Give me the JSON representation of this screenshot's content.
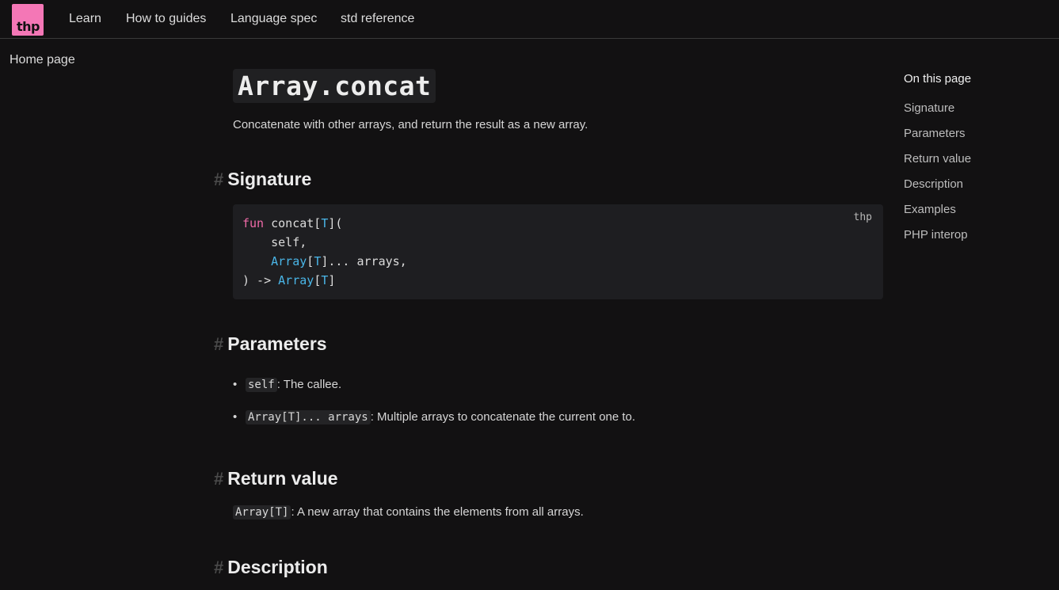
{
  "header": {
    "logo_text": "thp",
    "nav": [
      "Learn",
      "How to guides",
      "Language spec",
      "std reference"
    ]
  },
  "sidebar": {
    "home_label": "Home page"
  },
  "main": {
    "title": "Array.concat",
    "lead": "Concatenate with other arrays, and return the result as a new array.",
    "sections": {
      "signature": "Signature",
      "parameters": "Parameters",
      "return_value": "Return value",
      "description": "Description"
    },
    "code": {
      "language": "thp",
      "l1_kw": "fun",
      "l1_rest_a": " concat[",
      "l1_T": "T",
      "l1_rest_b": "](",
      "l2": "    self,",
      "l3_indent": "    ",
      "l3_type": "Array",
      "l3_b1": "[",
      "l3_T": "T",
      "l3_rest": "]... arrays,",
      "l4_a": ") -> ",
      "l4_type": "Array",
      "l4_b1": "[",
      "l4_T": "T",
      "l4_b2": "]"
    },
    "params": [
      {
        "code": "self",
        "text": ": The callee."
      },
      {
        "code": "Array[T]... arrays",
        "text": ": Multiple arrays to concatenate the current one to."
      }
    ],
    "return": {
      "code": "Array[T]",
      "text": ": A new array that contains the elements from all arrays."
    }
  },
  "toc": {
    "title": "On this page",
    "items": [
      "Signature",
      "Parameters",
      "Return value",
      "Description",
      "Examples",
      "PHP interop"
    ]
  },
  "colors": {
    "accent": "#f477b6",
    "keyword": "#f06aa8",
    "type": "#4ab6e8",
    "background": "#121112"
  }
}
